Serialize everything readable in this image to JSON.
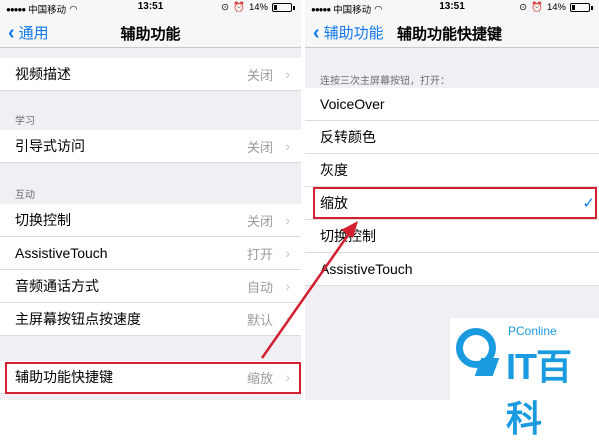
{
  "left": {
    "status": {
      "carrier": "中国移动",
      "time": "13:51",
      "battery": "14%"
    },
    "nav": {
      "back": "通用",
      "title": "辅助功能"
    },
    "rows": {
      "video_desc": {
        "label": "视频描述",
        "value": "关闭"
      },
      "guided": {
        "label": "引导式访问",
        "value": "关闭"
      },
      "switch": {
        "label": "切换控制",
        "value": "关闭"
      },
      "assistive": {
        "label": "AssistiveTouch",
        "value": "打开"
      },
      "audio": {
        "label": "音频通话方式",
        "value": "自动"
      },
      "home_speed": {
        "label": "主屏幕按钮点按速度",
        "value": "默认"
      },
      "shortcut": {
        "label": "辅助功能快捷键",
        "value": "缩放"
      }
    },
    "sections": {
      "learn": "学习",
      "interact": "互动"
    }
  },
  "right": {
    "status": {
      "carrier": "中国移动",
      "time": "13:51",
      "battery": "14%"
    },
    "nav": {
      "back": "辅助功能",
      "title": "辅助功能快捷键"
    },
    "section_header": "连按三次主屏幕按钮，打开：",
    "options": [
      "VoiceOver",
      "反转颜色",
      "灰度",
      "缩放",
      "切换控制",
      "AssistiveTouch"
    ],
    "checkmark": "✓"
  },
  "watermark": {
    "small": "PConline",
    "big": "IT百科"
  },
  "colors": {
    "accent": "#1278e8",
    "highlight": "#d31f30",
    "logo": "#1a9be0"
  }
}
